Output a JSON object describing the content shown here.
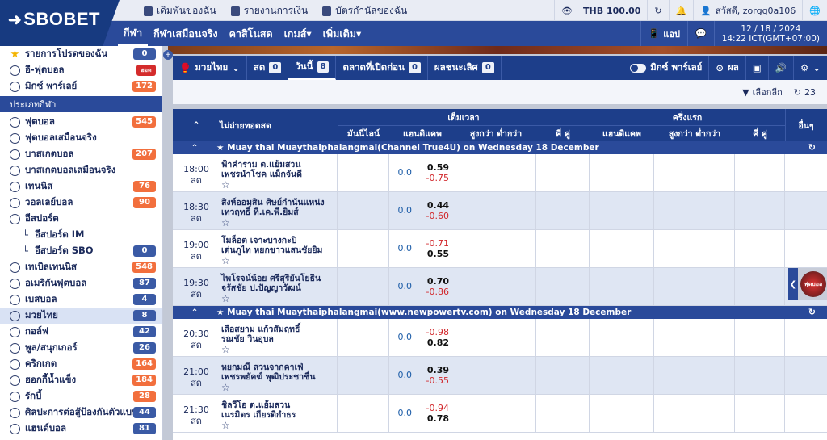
{
  "brand": {
    "name": "SBOBET"
  },
  "toplinks": [
    {
      "label": "เดิมพันของฉัน"
    },
    {
      "label": "รายงานการเงิน"
    },
    {
      "label": "บัตรกำนัลของฉัน"
    }
  ],
  "balance": "THB 100.00",
  "user": "สวัสดี, zorgg0a106",
  "nav": [
    {
      "label": "กีฬา"
    },
    {
      "label": "กีฬาเสมือนจริง"
    },
    {
      "label": "คาสิโนสด"
    },
    {
      "label": "เกมส์▾"
    },
    {
      "label": "เพิ่มเติม▾"
    }
  ],
  "app_label": "แอป",
  "datetime": {
    "date": "12 / 18 / 2024",
    "time": "14:22 ICT(GMT+07:00)"
  },
  "sidebar": {
    "top": [
      {
        "label": "รายการโปรดของฉัน",
        "count": "0",
        "color": "blue",
        "icon": "star-icon"
      },
      {
        "label": "อี-ฟุตบอล",
        "count": "ฮอต",
        "color": "hot",
        "icon": "efootball-icon"
      },
      {
        "label": "มิกซ์ พาร์เลย์",
        "count": "172",
        "color": "orange",
        "icon": "parlay-icon"
      }
    ],
    "section": "ประเภทกีฬา",
    "sports": [
      {
        "label": "ฟุตบอล",
        "count": "545",
        "color": "orange",
        "icon": "soccer-icon"
      },
      {
        "label": "ฟุตบอลเสมือนจริง",
        "count": "",
        "color": "",
        "icon": "virtual-soccer-icon"
      },
      {
        "label": "บาสเกตบอล",
        "count": "207",
        "color": "orange",
        "icon": "basketball-icon"
      },
      {
        "label": "บาสเกตบอลเสมือนจริง",
        "count": "",
        "color": "",
        "icon": "virtual-basketball-icon"
      },
      {
        "label": "เทนนิส",
        "count": "76",
        "color": "orange",
        "icon": "tennis-icon"
      },
      {
        "label": "วอลเลย์บอล",
        "count": "90",
        "color": "orange",
        "icon": "volleyball-icon"
      },
      {
        "label": "อีสปอร์ต",
        "count": "",
        "color": "",
        "icon": "esports-icon"
      },
      {
        "label": "อีสปอร์ต IM",
        "count": "",
        "color": "",
        "icon": "",
        "sub": true
      },
      {
        "label": "อีสปอร์ต SBO",
        "count": "0",
        "color": "blue",
        "icon": "",
        "sub": true
      },
      {
        "label": "เทเบิลเทนนิส",
        "count": "548",
        "color": "orange",
        "icon": "table-tennis-icon"
      },
      {
        "label": "อเมริกันฟุตบอล",
        "count": "87",
        "color": "blue",
        "icon": "american-football-icon"
      },
      {
        "label": "เบสบอล",
        "count": "4",
        "color": "blue",
        "icon": "baseball-icon"
      },
      {
        "label": "มวยไทย",
        "count": "8",
        "color": "blue",
        "icon": "muay-thai-icon",
        "active": true
      },
      {
        "label": "กอล์ฟ",
        "count": "42",
        "color": "blue",
        "icon": "golf-icon"
      },
      {
        "label": "พูล/สนุกเกอร์",
        "count": "26",
        "color": "blue",
        "icon": "pool-icon"
      },
      {
        "label": "คริกเกต",
        "count": "164",
        "color": "orange",
        "icon": "cricket-icon"
      },
      {
        "label": "ฮอกกี้น้ำแข็ง",
        "count": "184",
        "color": "orange",
        "icon": "ice-hockey-icon"
      },
      {
        "label": "รักบี้",
        "count": "28",
        "color": "orange",
        "icon": "rugby-icon"
      },
      {
        "label": "ศิลปะการต่อสู้ป้องกันตัวแบบผสม",
        "count": "44",
        "color": "blue",
        "icon": "mma-icon"
      },
      {
        "label": "แฮนด์บอล",
        "count": "81",
        "color": "blue",
        "icon": "handball-icon"
      }
    ]
  },
  "filters": [
    {
      "label": "มวยไทย",
      "badge": ""
    },
    {
      "label": "สด",
      "badge": "0"
    },
    {
      "label": "วันนี้",
      "badge": "8",
      "active": true
    },
    {
      "label": "ตลาดที่เปิดก่อน",
      "badge": "0"
    },
    {
      "label": "ผลชนะเลิศ",
      "badge": "0"
    }
  ],
  "mix_parlay": "มิกซ์ พาร์เลย์",
  "result_label": "ผล",
  "league_select": "เลือกลีก",
  "refresh_count": "23",
  "table": {
    "header": {
      "sort": "ไม่ถ่ายทอดสด",
      "fulltime": "เต็มเวลา",
      "firsthalf": "ครึ่งแรก",
      "other": "อื่นๆ",
      "cols": [
        "มันนี่ไลน์",
        "แฮนดิแคพ",
        "สูงกว่า ต่ำกว่า",
        "คี่ คู่",
        "แฮนดิแคพ",
        "สูงกว่า ต่ำกว่า",
        "คี่ คู่"
      ]
    },
    "leagues": [
      {
        "title": "★ Muay thai Muaythaiphalangmai(Channel True4U) on Wednesday 18 December",
        "matches": [
          {
            "time": "18:00",
            "status": "สด",
            "home": "ฟ้าคำราม ต.แย้มสวน",
            "away": "เพชรนำโชค แม็กจันดี",
            "hdp": "0.0",
            "o1": "0.59",
            "o2": "-0.75"
          },
          {
            "time": "18:30",
            "status": "สด",
            "home": "สิงห์ออมสิน ศิษย์กำนันแหน่ง",
            "away": "เทวฤทธิ์ ที.เค.พี.ยิมส์",
            "hdp": "0.0",
            "o1": "0.44",
            "o2": "-0.60"
          },
          {
            "time": "19:00",
            "status": "สด",
            "home": "โมล็อต เจาะบางกะปิ",
            "away": "เด่นภูไท หยกขาวแสนชัยยิม",
            "hdp": "0.0",
            "o1": "-0.71",
            "o2": "0.55"
          },
          {
            "time": "19:30",
            "status": "สด",
            "home": "ไพโรจน์น้อย ศรีสุริยันโยธิน",
            "away": "จรัสชัย ป.ปัญญาวัฒน์",
            "hdp": "0.0",
            "o1": "0.70",
            "o2": "-0.86"
          }
        ]
      },
      {
        "title": "★ Muay thai Muaythaiphalangmai(www.newpowertv.com) on Wednesday 18 December",
        "matches": [
          {
            "time": "20:30",
            "status": "สด",
            "home": "เสือสยาม แก้วสัมฤทธิ์",
            "away": "รณชัย วินอุบล",
            "hdp": "0.0",
            "o1": "-0.98",
            "o2": "0.82"
          },
          {
            "time": "21:00",
            "status": "สด",
            "home": "หยกมณี สวนจากคาเฟ่",
            "away": "เพชรพยัคฆ์ พุฒิประชาชื่น",
            "hdp": "0.0",
            "o1": "0.39",
            "o2": "-0.55"
          },
          {
            "time": "21:30",
            "status": "สด",
            "home": "ชิลวีโอ ต.แย้มสวน",
            "away": "เนรมิตร เกียรติกำธร",
            "hdp": "0.0",
            "o1": "-0.94",
            "o2": "0.78"
          }
        ]
      }
    ]
  },
  "promo_label": "ฟุตบอล"
}
